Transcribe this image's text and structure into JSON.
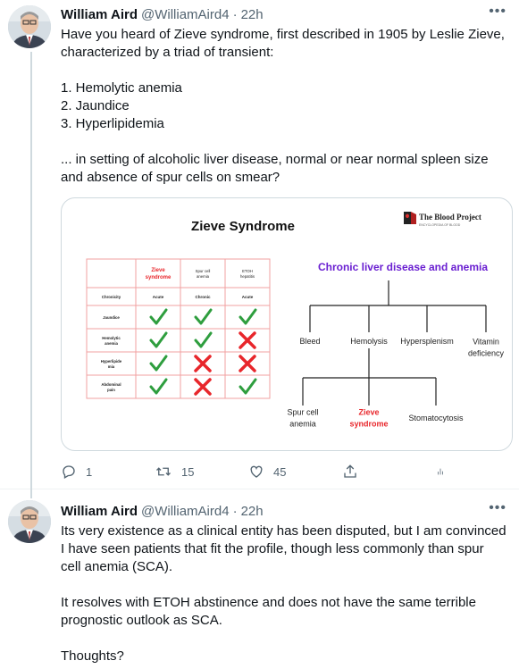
{
  "tweets": [
    {
      "author_name": "William Aird",
      "handle": "@WilliamAird4",
      "separator": "·",
      "time": "22h",
      "text": "Have you heard of Zieve syndrome, first described in 1905 by Leslie Zieve, characterized by a triad of transient:\n\n1. Hemolytic anemia\n2. Jaundice\n3. Hyperlipidemia\n\n... in setting of alcoholic liver disease, normal or near normal spleen size and absence of spur cells on smear?",
      "media": {
        "title": "Zieve Syndrome",
        "logo_text": "The Blood Project",
        "logo_subtext": "ENCYCLOPEDIA OF BLOOD",
        "table": {
          "headers": [
            "",
            "Zieve\nsyndrome",
            "Spur cell\nanemia",
            "ETOH\nhepatitis"
          ],
          "rows": [
            {
              "label": "Chronicity",
              "cells": [
                "Acute",
                "Chronic",
                "Acute"
              ]
            },
            {
              "label": "Jaundice",
              "cells": [
                "check",
                "check",
                "check"
              ]
            },
            {
              "label": "Hemolytic\nanemia",
              "cells": [
                "check",
                "check",
                "cross"
              ]
            },
            {
              "label": "Hyperlipide\nmia",
              "cells": [
                "check",
                "cross",
                "cross"
              ]
            },
            {
              "label": "Abdominal\npain",
              "cells": [
                "check",
                "cross",
                "check"
              ]
            }
          ]
        },
        "tree": {
          "root": "Chronic liver disease and anemia",
          "level1": [
            "Bleed",
            "Hemolysis",
            "Hypersplenism",
            "Vitamin\ndeficiency"
          ],
          "level2": [
            "Spur cell\nanemia",
            "Zieve\nsyndrome",
            "Stomatocytosis"
          ]
        },
        "colors": {
          "red": "#e8262b",
          "green": "#2e9e3e",
          "purple": "#6a1fd1",
          "table_border": "#f2a0a0"
        }
      },
      "actions": {
        "reply_count": "1",
        "retweet_count": "15",
        "like_count": "45"
      }
    },
    {
      "author_name": "William Aird",
      "handle": "@WilliamAird4",
      "separator": "·",
      "time": "22h",
      "text": "Its very existence as a clinical entity has been disputed, but I am convinced I have seen patients that fit the profile, though less commonly than spur cell anemia (SCA).\n\nIt resolves with ETOH abstinence and does not have the same terrible prognostic outlook as SCA.\n\nThoughts?"
    }
  ],
  "icons": {
    "more": "more-icon",
    "reply": "reply-icon",
    "retweet": "retweet-icon",
    "like": "like-icon",
    "share": "share-icon",
    "analytics": "analytics-icon"
  }
}
